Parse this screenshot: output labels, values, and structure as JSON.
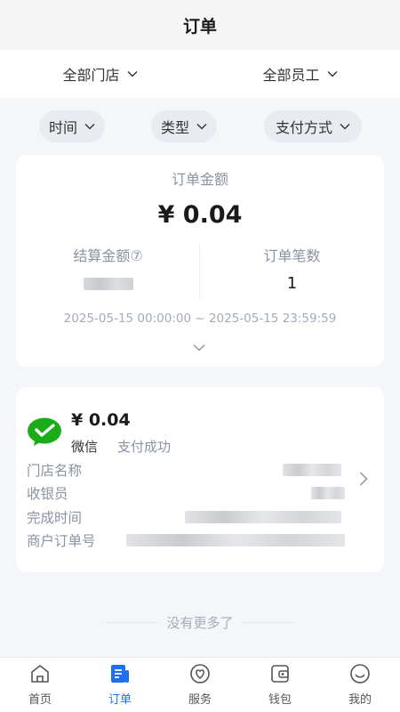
{
  "header": {
    "title": "订单"
  },
  "filters_top": [
    {
      "label": "全部门店"
    },
    {
      "label": "全部员工"
    }
  ],
  "filter_pills": [
    {
      "label": "时间"
    },
    {
      "label": "类型"
    },
    {
      "label": "支付方式"
    }
  ],
  "summary": {
    "amount_label": "订单金额",
    "amount": "¥ 0.04",
    "settle_label": "结算金额⑦",
    "count_label": "订单笔数",
    "count": "1",
    "range": "2025-05-15 00:00:00 ~ 2025-05-15 23:59:59"
  },
  "order": {
    "amount": "¥ 0.04",
    "method": "微信",
    "status": "支付成功",
    "fields": {
      "store": "门店名称",
      "cashier": "收银员",
      "completed": "完成时间",
      "merchant_order": "商户订单号"
    },
    "icon": "wechat-pay-icon"
  },
  "list_end_text": "没有更多了",
  "tabs": [
    {
      "label": "首页",
      "icon": "home-icon",
      "active": false
    },
    {
      "label": "订单",
      "icon": "orders-icon",
      "active": true
    },
    {
      "label": "服务",
      "icon": "service-icon",
      "active": false
    },
    {
      "label": "钱包",
      "icon": "wallet-icon",
      "active": false
    },
    {
      "label": "我的",
      "icon": "profile-icon",
      "active": false
    }
  ],
  "colors": {
    "accent": "#1f6ff1",
    "wechat_green": "#1aad19",
    "page_bg": "#f4f6fa"
  }
}
